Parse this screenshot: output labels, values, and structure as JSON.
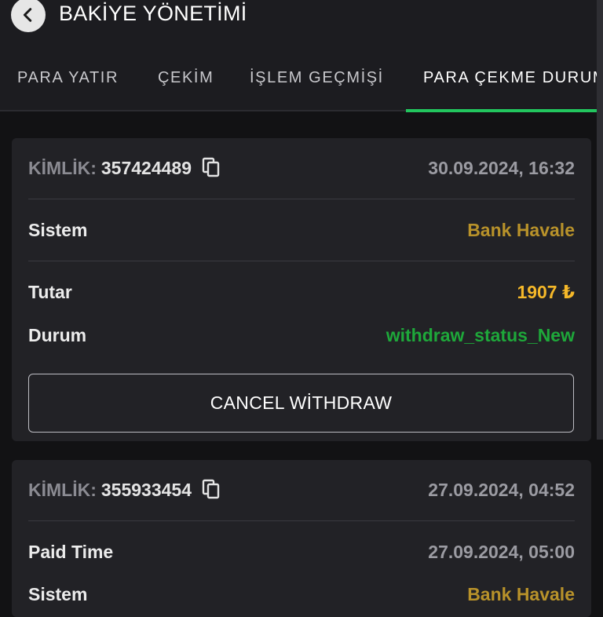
{
  "header": {
    "title": "BAKİYE YÖNETİMİ",
    "back_icon": "chevron-left-icon"
  },
  "tabs": [
    {
      "label": "PARA YATIR"
    },
    {
      "label": "ÇEKİM"
    },
    {
      "label": "İŞLEM GEÇMİŞİ"
    },
    {
      "label": "PARA ÇEKME DURUMU",
      "active": true
    }
  ],
  "colors": {
    "accent": "#22c55e",
    "system_value": "#b8922a",
    "amount": "#f5b829",
    "status": "#1ea83a"
  },
  "withdrawals": [
    {
      "id_label": "KİMLİK:",
      "id": "357424489",
      "date": "30.09.2024, 16:32",
      "system_label": "Sistem",
      "system": "Bank Havale",
      "amount_label": "Tutar",
      "amount": "1907 ₺",
      "status_label": "Durum",
      "status": "withdraw_status_New",
      "cancel_label": "CANCEL WİTHDRAW"
    },
    {
      "id_label": "KİMLİK:",
      "id": "355933454",
      "date": "27.09.2024, 04:52",
      "paid_time_label": "Paid Time",
      "paid_time": "27.09.2024, 05:00",
      "system_label": "Sistem",
      "system": "Bank Havale"
    }
  ]
}
